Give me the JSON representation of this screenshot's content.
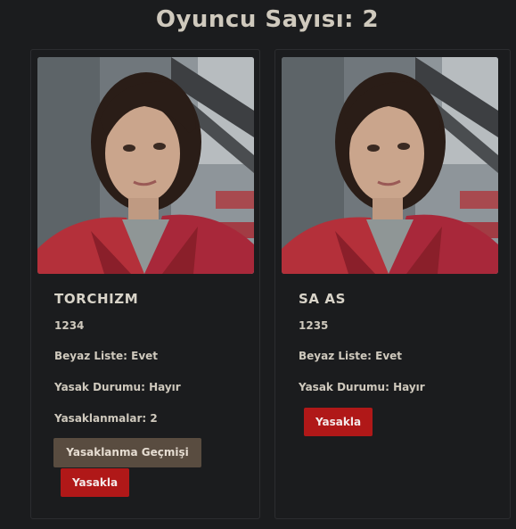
{
  "header": {
    "title": "Oyuncu Sayısı: 2"
  },
  "players": [
    {
      "name": "TORCHIZM",
      "id": "1234",
      "whitelist": "Beyaz Liste: Evet",
      "ban_status": "Yasak Durumu: Hayır",
      "ban_count": "Yasaklanmalar: 2",
      "history_button": "Yasaklanma Geçmişi",
      "ban_button": "Yasakla"
    },
    {
      "name": "SA AS",
      "id": "1235",
      "whitelist": "Beyaz Liste: Evet",
      "ban_status": "Yasak Durumu: Hayır",
      "ban_button": "Yasakla"
    }
  ],
  "colors": {
    "background": "#1b1c1e",
    "ban_button": "#b01818",
    "history_button": "#594c40",
    "text": "#d8d3c8"
  }
}
